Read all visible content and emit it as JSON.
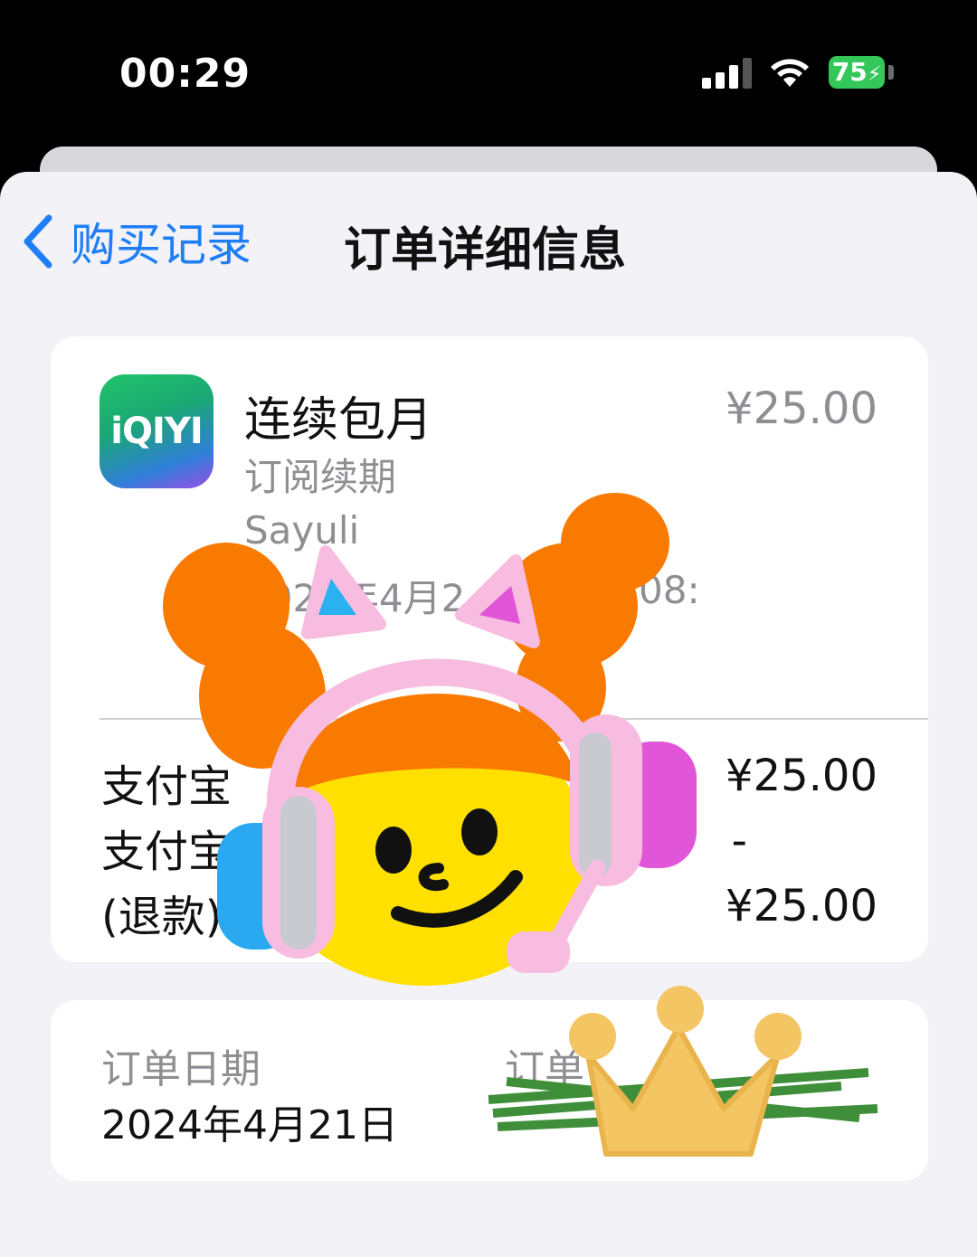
{
  "status_bar": {
    "time": "00:29",
    "battery": "75"
  },
  "nav": {
    "back_label": "购买记录",
    "title": "订单详细信息"
  },
  "item": {
    "app_icon_text": "iQIYI",
    "title": "连续包月",
    "subtitle": "订阅续期",
    "account": "Sayuli",
    "datetime": "2024年4月2",
    "datetime_tail": "08:",
    "price": "¥25.00"
  },
  "payments": [
    {
      "label": "支付宝",
      "amount": "¥25.00"
    },
    {
      "label": "支付宝",
      "amount": "-"
    },
    {
      "label": "(退款)",
      "amount": "¥25.00"
    }
  ],
  "meta": {
    "order_date_label": "订单日期",
    "order_date_value": "2024年4月21日",
    "order_id_label": "订单"
  },
  "colors": {
    "accent": "#1f7ef5",
    "battery": "#34c759",
    "background": "#f2f2f7"
  }
}
